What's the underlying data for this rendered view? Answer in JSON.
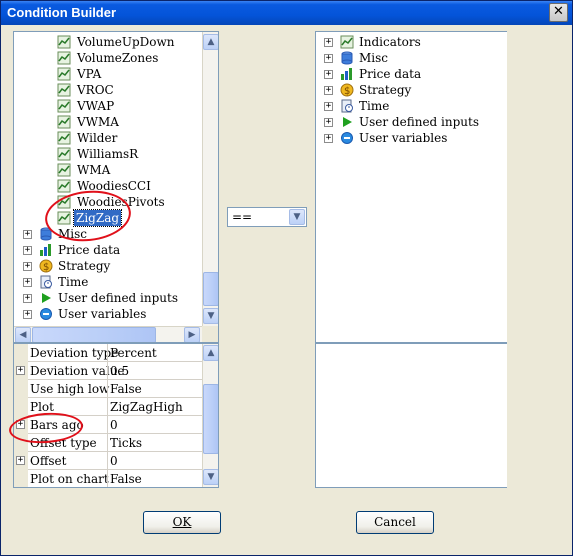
{
  "window": {
    "title": "Condition Builder",
    "close_glyph": "✕"
  },
  "left_tree": {
    "indicators": [
      "VolumeUpDown",
      "VolumeZones",
      "VPA",
      "VROC",
      "VWAP",
      "VWMA",
      "Wilder",
      "WilliamsR",
      "WMA",
      "WoodiesCCI",
      "WoodiesPivots",
      "ZigZag"
    ],
    "selected": "ZigZag",
    "categories": [
      {
        "label": "Misc",
        "icon": "database-icon"
      },
      {
        "label": "Price data",
        "icon": "bar-chart-icon"
      },
      {
        "label": "Strategy",
        "icon": "strategy-coin-icon"
      },
      {
        "label": "Time",
        "icon": "time-document-icon"
      },
      {
        "label": "User defined inputs",
        "icon": "play-arrow-icon"
      },
      {
        "label": "User variables",
        "icon": "globe-dot-icon"
      }
    ],
    "expander_plus": "+"
  },
  "properties": [
    {
      "name": "Deviation type",
      "value": "Percent",
      "expandable": false
    },
    {
      "name": "Deviation value",
      "value": "0.5",
      "expandable": true
    },
    {
      "name": "Use high low",
      "value": "False",
      "expandable": false
    },
    {
      "name": "Plot",
      "value": "ZigZagHigh",
      "expandable": false
    },
    {
      "name": "Bars ago",
      "value": "0",
      "expandable": true
    },
    {
      "name": "Offset type",
      "value": "Ticks",
      "expandable": false
    },
    {
      "name": "Offset",
      "value": "0",
      "expandable": true
    },
    {
      "name": "Plot on chart",
      "value": "False",
      "expandable": false
    }
  ],
  "operator_combo": {
    "value": "=="
  },
  "right_tree": {
    "categories": [
      {
        "label": "Indicators",
        "icon": "indicator-chart-icon"
      },
      {
        "label": "Misc",
        "icon": "database-icon"
      },
      {
        "label": "Price data",
        "icon": "bar-chart-icon"
      },
      {
        "label": "Strategy",
        "icon": "strategy-coin-icon"
      },
      {
        "label": "Time",
        "icon": "time-document-icon"
      },
      {
        "label": "User defined inputs",
        "icon": "play-arrow-icon"
      },
      {
        "label": "User variables",
        "icon": "globe-dot-icon"
      }
    ]
  },
  "buttons": {
    "ok": "OK",
    "cancel": "Cancel"
  },
  "colors": {
    "title_bar": "#0454d9",
    "selection": "#316ac5",
    "annotation_red": "#e0101a"
  }
}
